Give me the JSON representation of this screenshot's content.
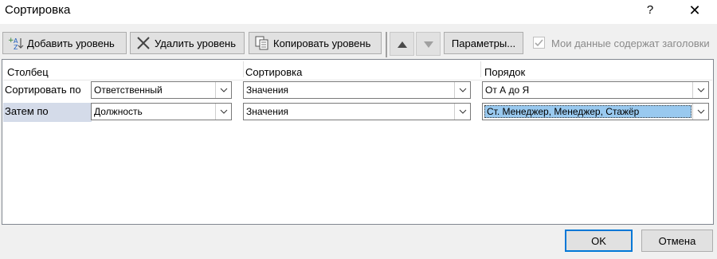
{
  "window": {
    "title": "Сортировка",
    "help": "?",
    "close": "✕"
  },
  "toolbar": {
    "add_label": "Добавить уровень",
    "delete_label": "Удалить уровень",
    "copy_label": "Копировать уровень",
    "options_label": "Параметры...",
    "headers_checkbox_label": "Мои данные содержат заголовки",
    "headers_checkbox_checked": true
  },
  "grid": {
    "columns": [
      "Столбец",
      "Сортировка",
      "Порядок"
    ],
    "rows": [
      {
        "label": "Сортировать по",
        "column": "Ответственный",
        "sort_on": "Значения",
        "order": "От А до Я"
      },
      {
        "label": "Затем по",
        "column": "Должность",
        "sort_on": "Значения",
        "order": "Ст. Менеджер, Менеджер, Стажёр"
      }
    ]
  },
  "footer": {
    "ok_label": "OK",
    "cancel_label": "Отмена"
  }
}
